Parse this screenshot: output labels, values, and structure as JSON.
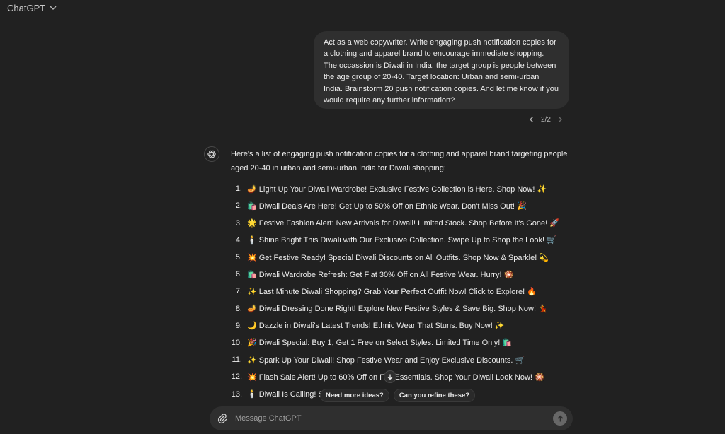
{
  "header": {
    "title": "ChatGPT"
  },
  "user_message": {
    "text": "Act as a web copywriter. Write engaging push notification copies for a clothing and apparel brand to encourage immediate shopping. The occassion is Diwali in India, the target group is people between the age group of 20-40. Target location: Urban and semi-urban India. Brainstorm 20 push notification copies. And let me know if you would require any further information?",
    "pager": "2/2"
  },
  "assistant": {
    "intro": "Here's a list of engaging push notification copies for a clothing and apparel brand targeting people aged 20-40 in urban and semi-urban India for Diwali shopping:",
    "items": [
      {
        "num": "1.",
        "text": "🪔 Light Up Your Diwali Wardrobe! Exclusive Festive Collection is Here. Shop Now! ✨"
      },
      {
        "num": "2.",
        "text": "🛍️ Diwali Deals Are Here! Get Up to 50% Off on Ethnic Wear. Don't Miss Out! 🎉"
      },
      {
        "num": "3.",
        "text": "🌟 Festive Fashion Alert: New Arrivals for Diwali! Limited Stock. Shop Before It's Gone! 🚀"
      },
      {
        "num": "4.",
        "text": "🕯️ Shine Bright This Diwali with Our Exclusive Collection. Swipe Up to Shop the Look! 🛒"
      },
      {
        "num": "5.",
        "text": "💥 Get Festive Ready! Special Diwali Discounts on All Outfits. Shop Now & Sparkle! 💫"
      },
      {
        "num": "6.",
        "text": "🛍️ Diwali Wardrobe Refresh: Get Flat 30% Off on All Festive Wear. Hurry! 🎇"
      },
      {
        "num": "7.",
        "text": "✨ Last Minute Diwali Shopping? Grab Your Perfect Outfit Now! Click to Explore! 🔥"
      },
      {
        "num": "8.",
        "text": "🪔 Diwali Dressing Done Right! Explore New Festive Styles & Save Big. Shop Now! 💃"
      },
      {
        "num": "9.",
        "text": "🌙 Dazzle in Diwali's Latest Trends! Ethnic Wear That Stuns. Buy Now! ✨"
      },
      {
        "num": "10.",
        "text": "🎉 Diwali Special: Buy 1, Get 1 Free on Select Styles. Limited Time Only! 🛍️"
      },
      {
        "num": "11.",
        "text": "✨ Spark Up Your Diwali! Shop Festive Wear and Enjoy Exclusive Discounts. 🛒"
      },
      {
        "num": "12.",
        "text": "💥 Flash Sale Alert! Up to 60% Off on Fes     Essentials. Shop Your Diwali Look Now! 🎇"
      },
      {
        "num": "13.",
        "text": "🕯️ Diwali Is Calling! Sh                                    Celebrations. 🛍️"
      }
    ]
  },
  "suggestions": [
    "Need more ideas?",
    "Can you refine these?"
  ],
  "composer": {
    "placeholder": "Message ChatGPT"
  }
}
